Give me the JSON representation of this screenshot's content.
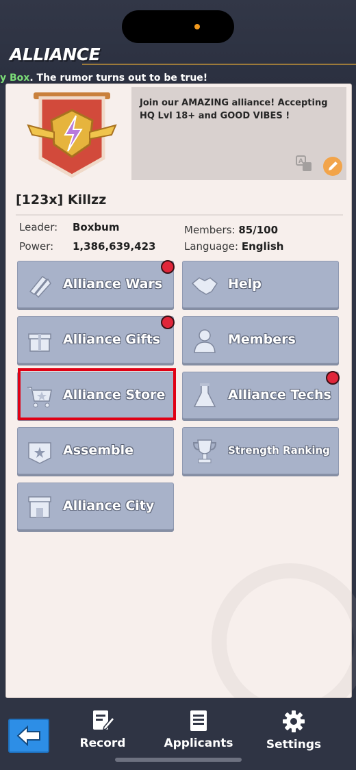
{
  "header": {
    "title": "ALLIANCE",
    "ticker_highlight": "y Box",
    "ticker_text": ". The rumor turns out to be true!"
  },
  "alliance": {
    "description": "Join our AMAZING alliance! Accepting HQ Lvl 18+ and GOOD VIBES !",
    "name": "[123x] Killzz",
    "leader_label": "Leader:",
    "leader_value": "Boxbum",
    "power_label": "Power:",
    "power_value": "1,386,639,423",
    "members_label": "Members:",
    "members_value": "85/100",
    "language_label": "Language:",
    "language_value": "English"
  },
  "menu": {
    "alliance_wars": "Alliance Wars",
    "help": "Help",
    "alliance_gifts": "Alliance Gifts",
    "members": "Members",
    "alliance_store": "Alliance Store",
    "alliance_techs": "Alliance Techs",
    "assemble": "Assemble",
    "strength_ranking": "Strength Ranking",
    "alliance_city": "Alliance City"
  },
  "nav": {
    "record": "Record",
    "applicants": "Applicants",
    "settings": "Settings"
  },
  "colors": {
    "button": "#a8b2c9",
    "panel": "#f7efec",
    "badge": "#e0263a",
    "highlight": "#e00014",
    "back_button": "#2d8ee6"
  },
  "icons": [
    "back-arrow-icon",
    "record-icon",
    "applicants-icon",
    "settings-gear-icon",
    "translate-icon",
    "edit-pencil-icon"
  ]
}
